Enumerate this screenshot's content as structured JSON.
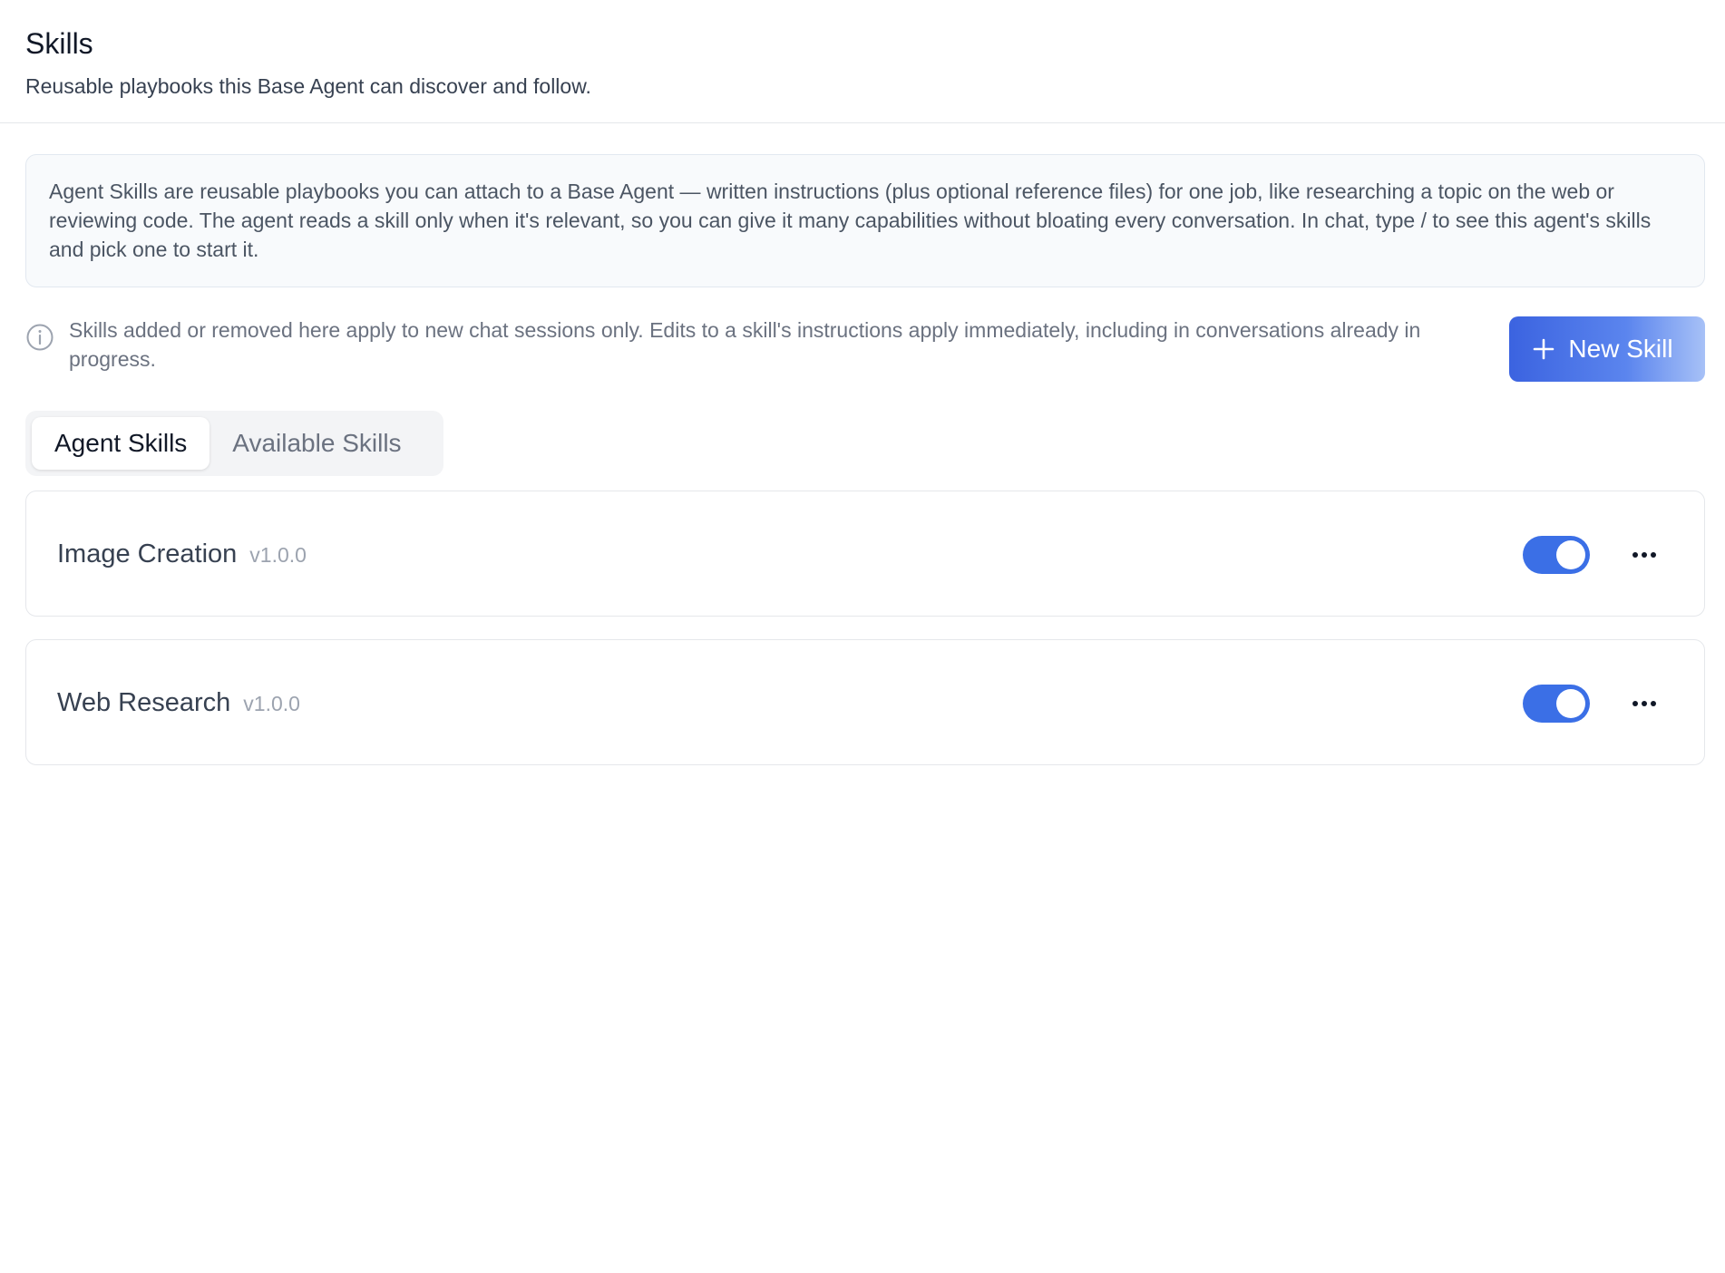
{
  "header": {
    "title": "Skills",
    "subtitle": "Reusable playbooks this Base Agent can discover and follow."
  },
  "intro": {
    "text": "Agent Skills are reusable playbooks you can attach to a Base Agent — written instructions (plus optional reference files) for one job, like researching a topic on the web or reviewing code. The agent reads a skill only when it's relevant, so you can give it many capabilities without bloating every conversation. In chat, type / to see this agent's skills and pick one to start it."
  },
  "notice": {
    "icon": "info-icon",
    "text": "Skills added or removed here apply to new chat sessions only. Edits to a skill's instructions apply immediately, including in conversations already in progress."
  },
  "toolbar": {
    "new_skill_label": "New Skill",
    "new_skill_icon": "plus-icon"
  },
  "tabs": [
    {
      "label": "Agent Skills",
      "active": true
    },
    {
      "label": "Available Skills",
      "active": false
    }
  ],
  "skills": [
    {
      "name": "Image Creation",
      "version": "v1.0.0",
      "enabled": true
    },
    {
      "name": "Web Research",
      "version": "v1.0.0",
      "enabled": true
    }
  ],
  "colors": {
    "accent": "#3b6fe6",
    "button_gradient_start": "#3b63e0",
    "button_gradient_end": "#a7c1f7",
    "intro_background": "#f8fafc"
  }
}
